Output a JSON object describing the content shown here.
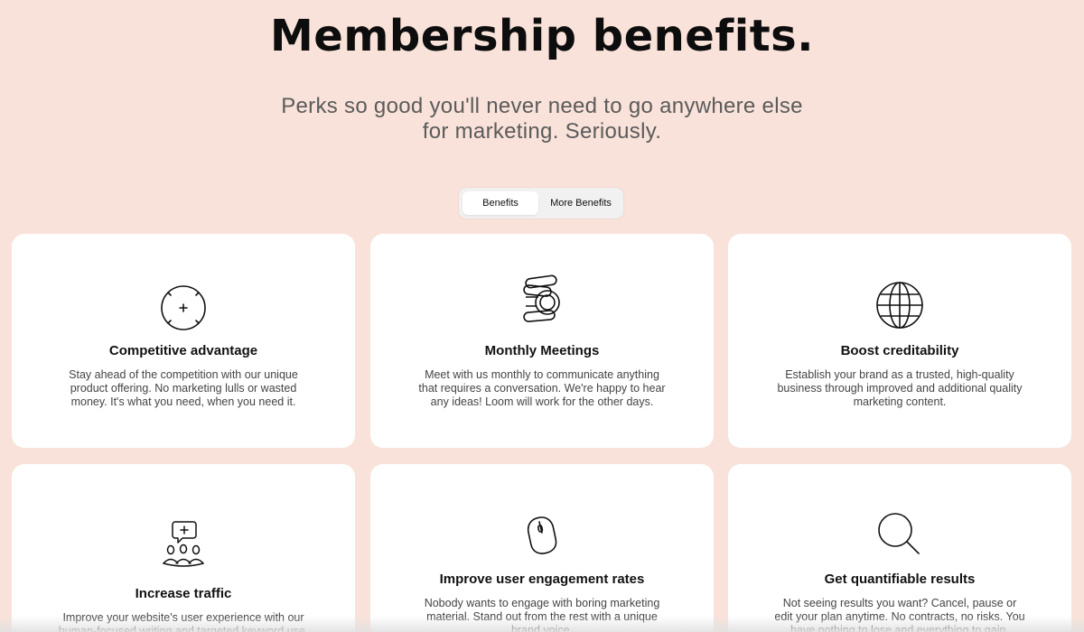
{
  "header": {
    "title": "Membership benefits.",
    "subtitle": "Perks so good you'll never need to go anywhere else for marketing. Seriously."
  },
  "tabs": [
    {
      "label": "Benefits",
      "active": true
    },
    {
      "label": "More Benefits",
      "active": false
    }
  ],
  "cards": [
    {
      "icon": "target-crosshair-icon",
      "title": "Competitive advantage",
      "description": "Stay ahead of the competition with our unique product offering. No marketing lulls or wasted money. It's what you need, when you need it."
    },
    {
      "icon": "coins-stack-icon",
      "title": "Monthly Meetings",
      "description": "Meet with us monthly to communicate anything that requires a conversation. We're happy to hear any ideas! Loom will work for the other days."
    },
    {
      "icon": "globe-icon",
      "title": "Boost creditability",
      "description": "Establish your brand as a trusted, high-quality business through improved and additional quality marketing content."
    },
    {
      "icon": "audience-chat-icon",
      "title": "Increase traffic",
      "description": "Improve your website's user experience with our human-focused writing and targeted keyword use."
    },
    {
      "icon": "mouse-icon",
      "title": "Improve user engagement rates",
      "description": "Nobody wants to engage with boring marketing material. Stand out from the rest with a unique brand voice."
    },
    {
      "icon": "magnifier-icon",
      "title": "Get quantifiable results",
      "description": "Not seeing results you want? Cancel, pause or edit your plan anytime. No contracts, no risks. You have nothing to lose and everything to gain."
    }
  ]
}
